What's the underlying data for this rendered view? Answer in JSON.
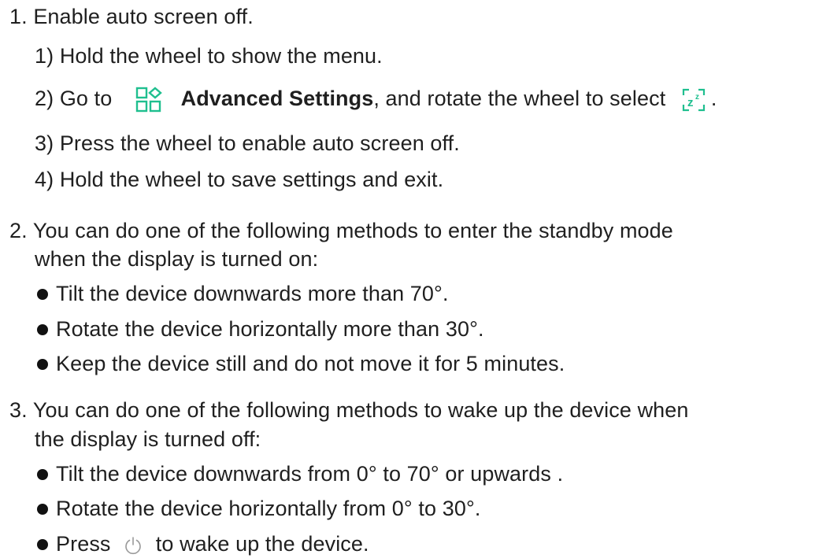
{
  "colors": {
    "text": "#1f1f1f",
    "icon_accent": "#1fbf8f",
    "power_icon": "#9a9a9a"
  },
  "steps": {
    "step1": {
      "number": "1.",
      "text": "Enable auto screen off.",
      "substeps": [
        {
          "number": "1)",
          "text": "Hold the wheel to show the menu."
        },
        {
          "number": "2)",
          "text_before_icon": "Go to",
          "icon": "advanced-settings-icon",
          "bold_text": "Advanced Settings",
          "text_after_bold": ", and rotate the wheel to select",
          "trailing_icon": "auto-screen-off-icon",
          "end": "."
        },
        {
          "number": "3)",
          "text": "Press the wheel to enable auto screen off."
        },
        {
          "number": "4)",
          "text": "Hold the wheel to save settings and exit."
        }
      ]
    },
    "step2": {
      "number": "2.",
      "line1": "You can do one of the following methods to enter the standby mode",
      "line2": "when the display is turned on:",
      "bullets": [
        "Tilt the device downwards more than 70°.",
        "Rotate the device horizontally more than 30°.",
        "Keep the device still and do not move it for 5 minutes."
      ]
    },
    "step3": {
      "number": "3.",
      "line1": "You can do one of the following methods to wake up the device when",
      "line2": "the display is turned off:",
      "bullets": [
        "Tilt the device downwards from 0° to 70° or upwards .",
        "Rotate the device horizontally from 0° to 30°."
      ],
      "last_bullet": {
        "before_icon": "Press",
        "icon": "power-icon",
        "after_icon": "to wake up the device."
      }
    }
  }
}
